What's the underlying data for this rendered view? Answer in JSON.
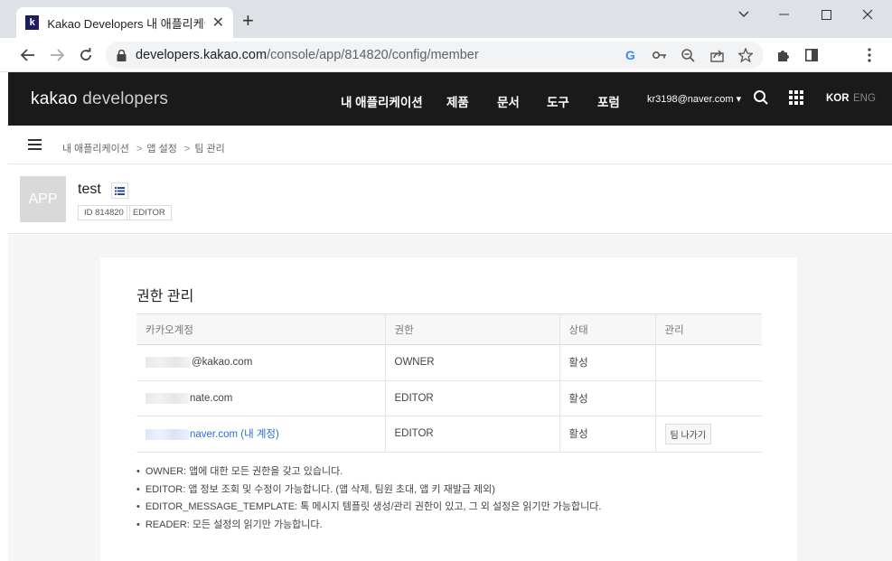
{
  "browser": {
    "tab_title": "Kakao Developers 내 애플리케이션",
    "favicon_letter": "k",
    "url_host": "developers.kakao.com",
    "url_path": "/console/app/814820/config/member"
  },
  "header": {
    "logo_main": "kakao",
    "logo_sub": "developers",
    "nav": [
      "내 애플리케이션",
      "제품",
      "문서",
      "도구",
      "포럼"
    ],
    "user": "kr3198@naver.com ▾",
    "lang_active": "KOR",
    "lang_other": "ENG"
  },
  "breadcrumb": [
    "내 애플리케이션",
    "앱 설정",
    "팀 관리"
  ],
  "breadcrumb_sep": ">",
  "app": {
    "thumb_text": "APP",
    "name": "test",
    "badges": [
      "ID 814820",
      "EDITOR"
    ]
  },
  "card": {
    "title": "권한 관리",
    "columns": [
      "카카오계정",
      "권한",
      "상태",
      "관리"
    ],
    "rows": [
      {
        "account": "@kakao.com",
        "role": "OWNER",
        "status": "활성",
        "action": ""
      },
      {
        "account": "nate.com",
        "role": "EDITOR",
        "status": "활성",
        "action": ""
      },
      {
        "account": "naver.com (내 계정)",
        "role": "EDITOR",
        "status": "활성",
        "action": "팀 나가기"
      }
    ],
    "notes": [
      "OWNER: 앱에 대한 모든 권한을 갖고 있습니다.",
      "EDITOR: 앱 정보 조회 및 수정이 가능합니다. (앱 삭제, 팀원 초대, 앱 키 재발급 제외)",
      "EDITOR_MESSAGE_TEMPLATE: 톡 메시지 템플릿 생성/관리 권한이 있고, 그 외 설정은 읽기만 가능합니다.",
      "READER: 모든 설정의 읽기만 가능합니다."
    ]
  },
  "colors": {
    "header_bg": "#1a1a1a",
    "link": "#2a6fd6"
  }
}
